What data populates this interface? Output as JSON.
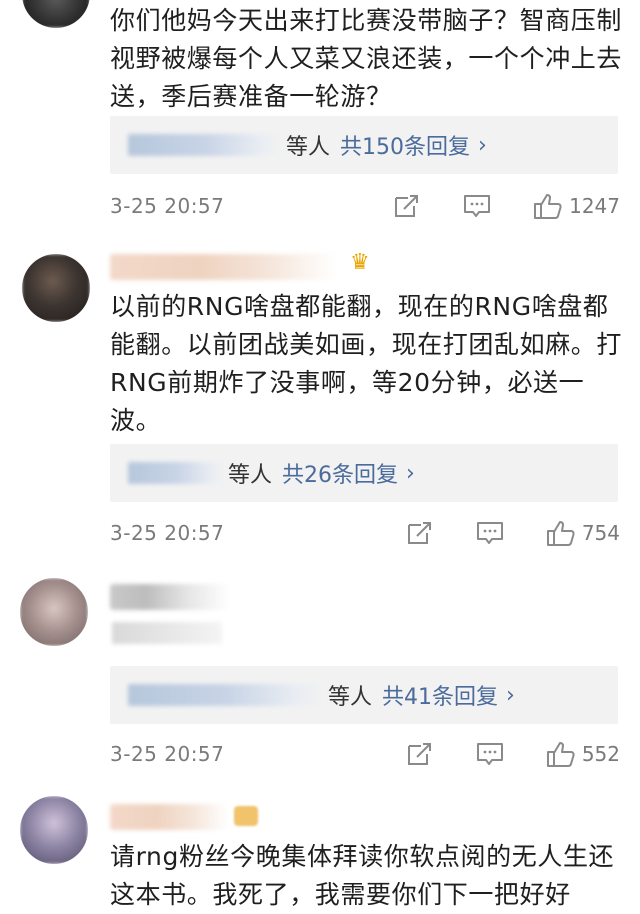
{
  "comments": [
    {
      "content": "你们他妈今天出来打比赛没带脑子？智商压制视野被爆每个人又菜又浪还装，一个个冲上去送，季后赛准备一轮游？",
      "reply_suffix": "等人",
      "reply_count": "共150条回复",
      "time": "3-25 20:57",
      "likes": "1247"
    },
    {
      "content": "以前的RNG啥盘都能翻，现在的RNG啥盘都能翻。以前团战美如画，现在打团乱如麻。打RNG前期炸了没事啊，等20分钟，必送一波。",
      "reply_suffix": "等人",
      "reply_count": "共26条回复",
      "time": "3-25 20:57",
      "likes": "754"
    },
    {
      "content": "",
      "reply_suffix": "等人",
      "reply_count": "共41条回复",
      "time": "3-25 20:57",
      "likes": "552"
    },
    {
      "content": "请rng粉丝今晚集体拜读你软点阅的无人生还这本书。我死了，我需要你们下一把好好"
    }
  ],
  "colors": {
    "link": "#4a6b9b",
    "meta": "#7a7a7a",
    "reply_bg": "#f2f2f2"
  },
  "icons": {
    "share": "share-icon",
    "comment": "comment-icon",
    "like": "thumbs-up-icon",
    "vip": "crown-icon"
  }
}
